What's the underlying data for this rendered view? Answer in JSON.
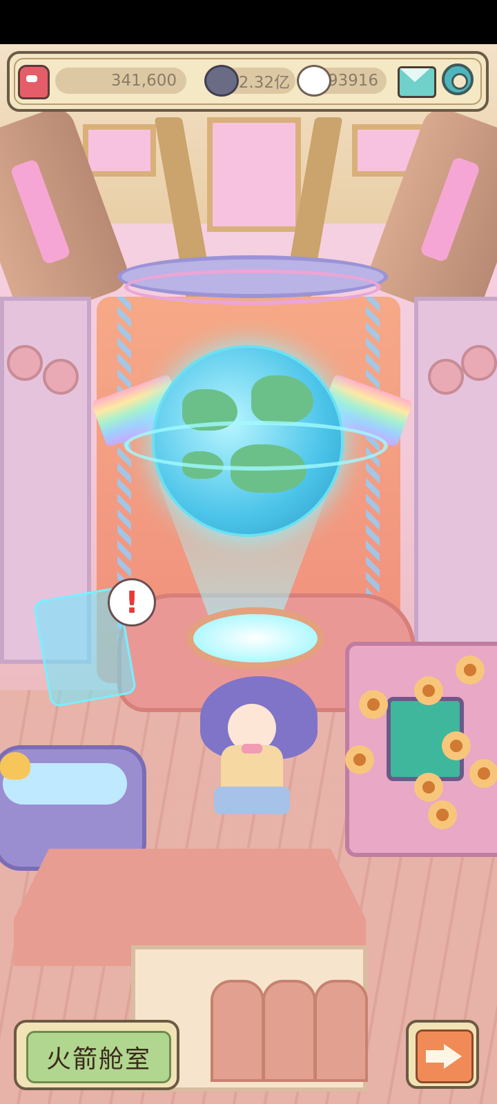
{
  "hud": {
    "gold_value": "341,600",
    "cloud_currency_value": "2.32亿",
    "cookie_currency_value": "93916",
    "icons": [
      "robot-icon",
      "cloud-icon",
      "cookie-icon",
      "mail-icon",
      "gear-icon"
    ]
  },
  "scene": {
    "alert_symbol": "!"
  },
  "bottom": {
    "room_button_label": "火箭舱室",
    "next_button_icon": "arrow-right-icon"
  },
  "colors": {
    "hud_bg": "#f3e6c4",
    "room_button_green": "#b1d68f",
    "next_button_orange": "#f08b58",
    "gear_teal": "#4fb5bd"
  }
}
